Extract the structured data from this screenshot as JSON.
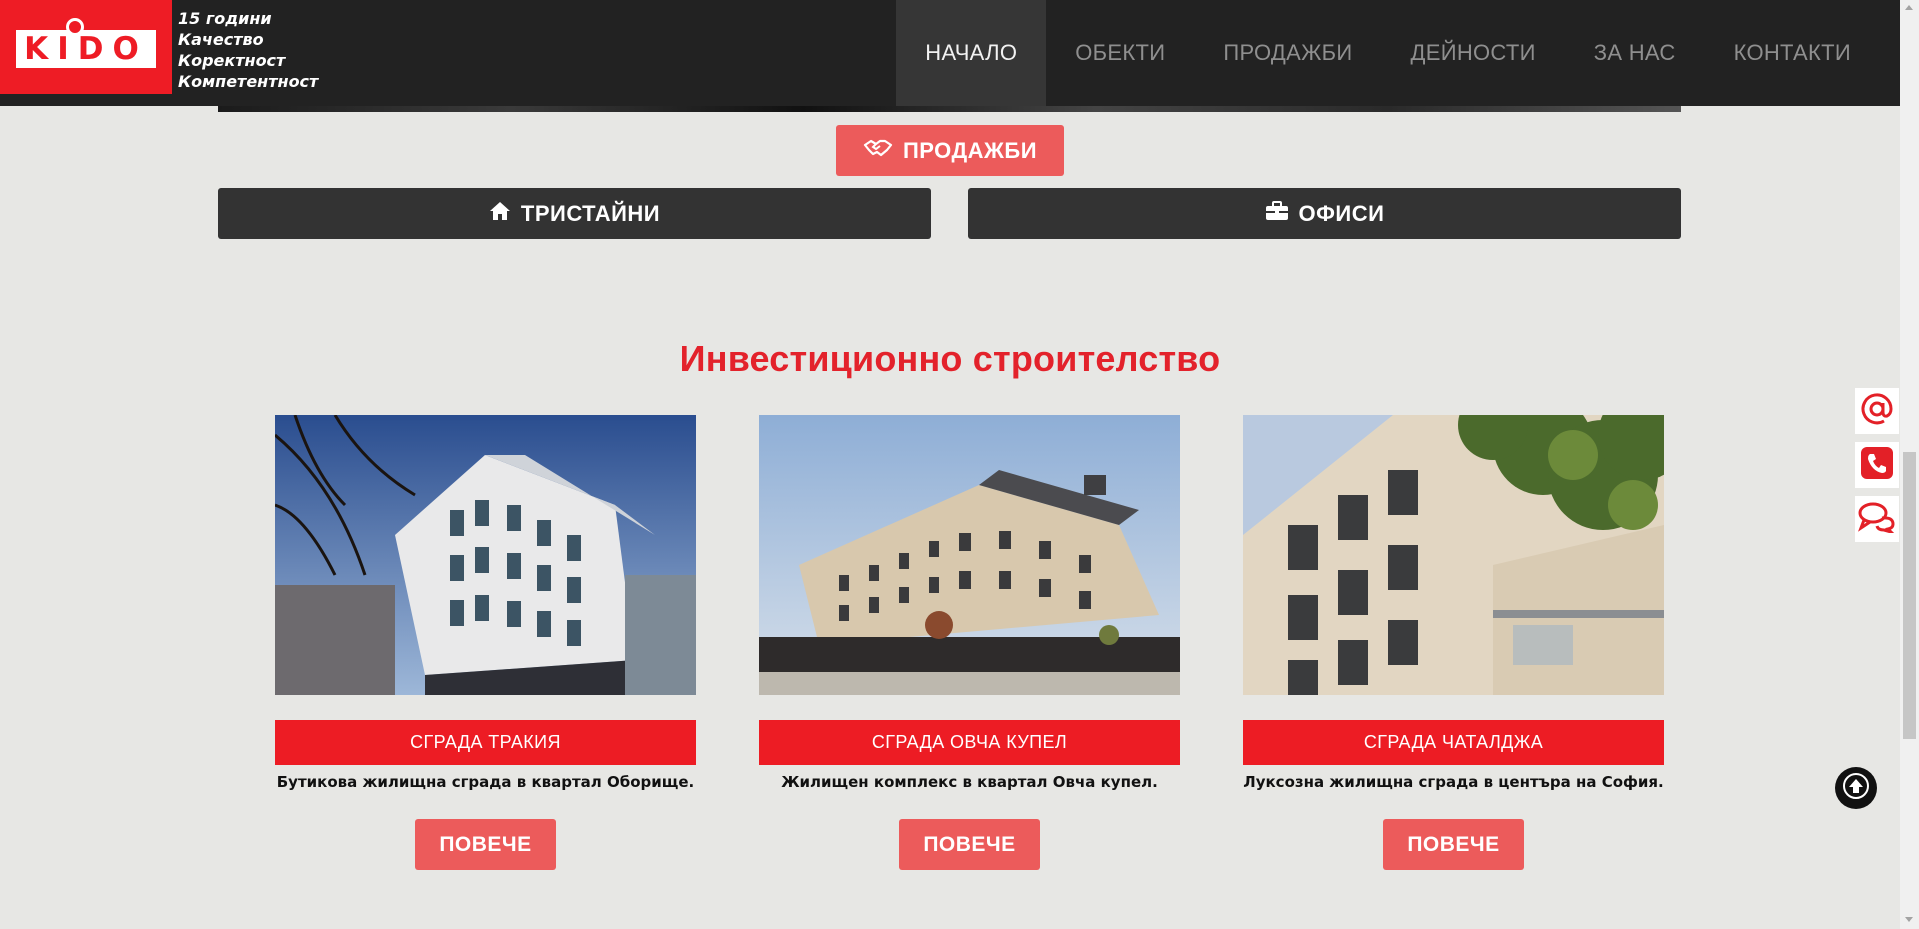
{
  "header": {
    "logo_text": "KIDO",
    "tagline": [
      "15 години",
      "Качество",
      "Коректност",
      "Компетентност"
    ],
    "menu": [
      {
        "label": "НАЧАЛО",
        "active": true
      },
      {
        "label": "ОБЕКТИ",
        "active": false
      },
      {
        "label": "ПРОДАЖБИ",
        "active": false
      },
      {
        "label": "ДЕЙНОСТИ",
        "active": false
      },
      {
        "label": "ЗА НАС",
        "active": false
      },
      {
        "label": "КОНТАКТИ",
        "active": false
      }
    ]
  },
  "buttons": {
    "sales": {
      "label": "ПРОДАЖБИ",
      "icon": "handshake-icon"
    },
    "three_room": {
      "label": "ТРИСТАЙНИ",
      "icon": "home-icon"
    },
    "offices": {
      "label": "ОФИСИ",
      "icon": "briefcase-icon"
    }
  },
  "section": {
    "title": "Инвестиционно строителство"
  },
  "projects": [
    {
      "title": "СГРАДА ТРАКИЯ",
      "description": "Бутикова жилищна сграда в квартал Оборище.",
      "more_label": "ПОВЕЧЕ"
    },
    {
      "title": "СГРАДА ОВЧА КУПЕЛ",
      "description": "Жилищен комплекс в квартал Овча купел.",
      "more_label": "ПОВЕЧЕ"
    },
    {
      "title": "СГРАДА ЧАТАЛДЖА",
      "description": "Луксозна жилищна сграда в центъра на София.",
      "more_label": "ПОВЕЧЕ"
    }
  ],
  "side_widgets": [
    "email-icon",
    "phone-icon",
    "chat-icon"
  ],
  "colors": {
    "brand_red": "#ed1c24",
    "button_coral": "#ec5b5b",
    "dark": "#222222",
    "background": "#e7e7e4"
  }
}
